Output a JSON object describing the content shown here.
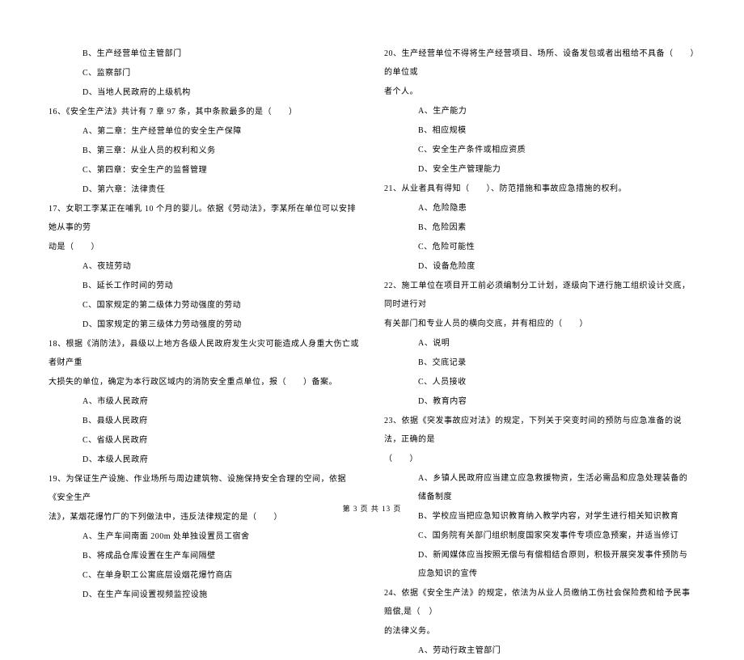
{
  "left_column": {
    "q15_options": [
      "B、生产经营单位主管部门",
      "C、监察部门",
      "D、当地人民政府的上级机构"
    ],
    "q16_stem": "16、《安全生产法》共计有 7 章 97 条，其中条款最多的是（　　）",
    "q16_options": [
      "A、第二章：生产经营单位的安全生产保障",
      "B、第三章：从业人员的权利和义务",
      "C、第四章：安全生产的监督管理",
      "D、第六章：法律责任"
    ],
    "q17_stem_1": "17、女职工李某正在哺乳 10 个月的婴儿。依据《劳动法》，李某所在单位可以安排她从事的劳",
    "q17_stem_2": "动是（　　）",
    "q17_options": [
      "A、夜班劳动",
      "B、延长工作时间的劳动",
      "C、国家规定的第二级体力劳动强度的劳动",
      "D、国家规定的第三级体力劳动强度的劳动"
    ],
    "q18_stem_1": "18、根据《消防法》，县级以上地方各级人民政府发生火灾可能造成人身重大伤亡或者财产重",
    "q18_stem_2": "大损失的单位，确定为本行政区域内的消防安全重点单位，报（　　）备案。",
    "q18_options": [
      "A、市级人民政府",
      "B、县级人民政府",
      "C、省级人民政府",
      "D、本级人民政府"
    ],
    "q19_stem_1": "19、为保证生产设施、作业场所与周边建筑物、设施保持安全合理的空间，依据《安全生产",
    "q19_stem_2": "法》，某烟花爆竹厂的下列做法中，违反法律规定的是（　　）",
    "q19_options": [
      "A、生产车间南面 200m 处单独设置员工宿舍",
      "B、将成品仓库设置在生产车间隔壁",
      "C、在单身职工公寓底层设烟花爆竹商店",
      "D、在生产车间设置视频监控设施"
    ]
  },
  "right_column": {
    "q20_stem_1": "20、生产经营单位不得将生产经营项目、场所、设备发包或者出租给不具备（　　）的单位或",
    "q20_stem_2": "者个人。",
    "q20_options": [
      "A、生产能力",
      "B、相应规模",
      "C、安全生产条件或相应资质",
      "D、安全生产管理能力"
    ],
    "q21_stem": "21、从业者具有得知（　　）、防范措施和事故应急措施的权利。",
    "q21_options": [
      "A、危险隐患",
      "B、危险因素",
      "C、危险可能性",
      "D、设备危险度"
    ],
    "q22_stem_1": "22、施工单位在项目开工前必须编制分工计划，逐级向下进行施工组织设计交底，同时进行对",
    "q22_stem_2": "有关部门和专业人员的横向交底，并有相应的（　　）",
    "q22_options": [
      "A、说明",
      "B、交底记录",
      "C、人员接收",
      "D、教育内容"
    ],
    "q23_stem_1": "23、依据《突发事故应对法》的规定，下列关于突变时间的预防与应急准备的说法，正确的是",
    "q23_stem_2": "（　　）",
    "q23_options": [
      "A、乡镇人民政府应当建立应急救援物资，生活必需品和应急处理装备的储备制度",
      "B、学校应当把应急知识教育纳入教学内容，对学生进行相关知识教育",
      "C、国务院有关部门组织制度国家突发事件专项应急预案，并适当修订",
      "D、新闻媒体应当按照无偿与有偿相结合原则，积极开展突发事件预防与应急知识的宣传"
    ],
    "q24_stem_1": "24、依据《安全生产法》的规定，依法为从业人员缴纳工伤社会保险费和给予民事赔偿,是（　）",
    "q24_stem_2": "的法律义务。",
    "q24_options": [
      "A、劳动行政主管部门"
    ]
  },
  "footer": "第 3 页 共 13 页"
}
